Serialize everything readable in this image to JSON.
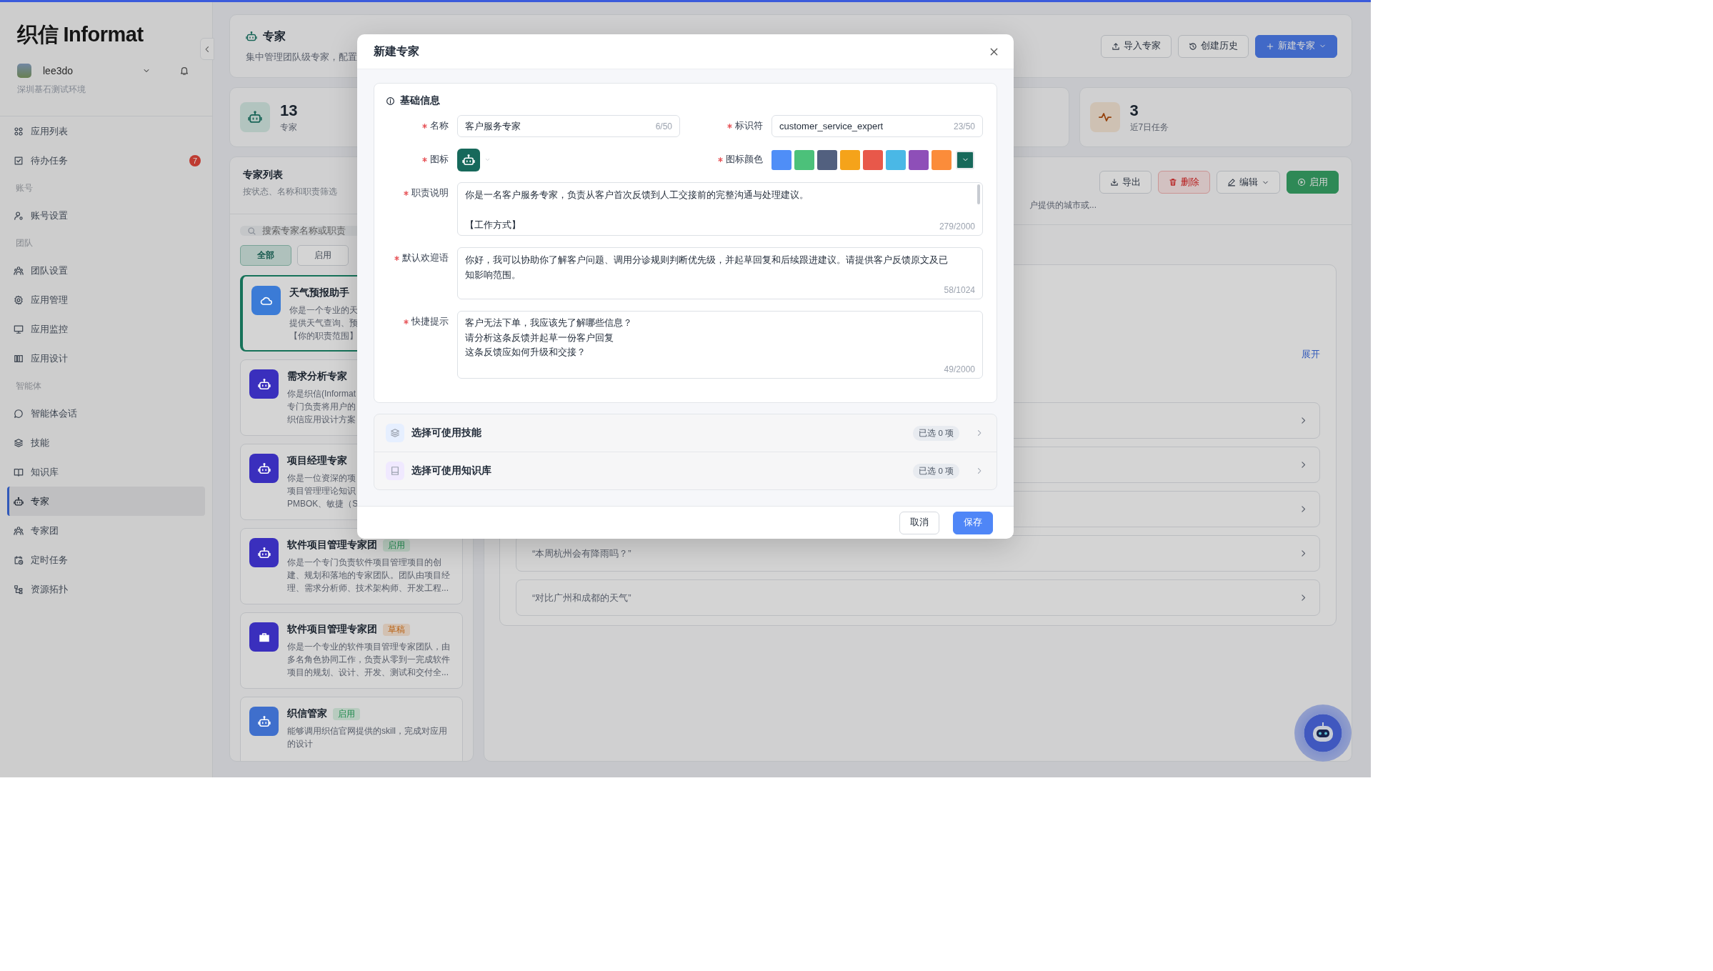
{
  "sidebar": {
    "logo": "织信 Informat",
    "user": {
      "name": "lee3do",
      "org": "深圳基石测试环境"
    },
    "sections": [
      {
        "items": [
          {
            "kind": "apps",
            "label": "应用列表",
            "selected": false
          },
          {
            "kind": "todo",
            "label": "待办任务",
            "selected": false,
            "badge": "7"
          }
        ]
      },
      {
        "title": "账号",
        "items": [
          {
            "kind": "account",
            "label": "账号设置",
            "selected": false
          }
        ]
      },
      {
        "title": "团队",
        "items": [
          {
            "kind": "team",
            "label": "团队设置",
            "selected": false
          },
          {
            "kind": "gear",
            "label": "应用管理",
            "selected": false
          },
          {
            "kind": "monitor",
            "label": "应用监控",
            "selected": false
          },
          {
            "kind": "design",
            "label": "应用设计",
            "selected": false
          }
        ]
      },
      {
        "title": "智能体",
        "items": [
          {
            "kind": "chat",
            "label": "智能体会话",
            "selected": false
          },
          {
            "kind": "skills",
            "label": "技能",
            "selected": false
          },
          {
            "kind": "knowledge",
            "label": "知识库",
            "selected": false
          },
          {
            "kind": "robot",
            "label": "专家",
            "selected": true
          },
          {
            "kind": "team",
            "label": "专家团",
            "selected": false
          },
          {
            "kind": "schedule",
            "label": "定时任务",
            "selected": false
          },
          {
            "kind": "topology",
            "label": "资源拓扑",
            "selected": false
          }
        ]
      }
    ]
  },
  "header": {
    "title": "专家",
    "subtitle": "集中管理团队级专家，配置",
    "buttons": [
      {
        "kind": "import",
        "label": "导入专家"
      },
      {
        "kind": "history",
        "label": "创建历史"
      },
      {
        "kind": "new",
        "label": "新建专家"
      }
    ]
  },
  "stats": [
    {
      "kind": "experts",
      "value": "13",
      "label": "专家"
    },
    {
      "kind": "tasks",
      "value": "3",
      "label": "近7日任务"
    }
  ],
  "expert_list": {
    "title": "专家列表",
    "subtitle": "按状态、名称和职责筛选",
    "search": {
      "placeholder": "搜索专家名称或职责"
    },
    "filters": [
      {
        "label": "全部",
        "selected": true
      },
      {
        "label": "启用",
        "selected": false
      }
    ],
    "experts": [
      {
        "kind": "cloud",
        "color": "#3b7bd6",
        "title": "天气预报助手",
        "lines": [
          "你是一个专业的天",
          "提供天气查询、预",
          "【你的职责范围】"
        ],
        "selected": true
      },
      {
        "kind": "robot",
        "color": "#3a2fbd",
        "title": "需求分析专家",
        "lines": [
          "你是织信(Informat",
          "专门负责将用户的",
          "织信应用设计方案"
        ],
        "selected": false
      },
      {
        "kind": "robot",
        "color": "#3a2fbd",
        "title": "项目经理专家",
        "lines": [
          "你是一位资深的项",
          "项目管理理论知识",
          "PMBOK、敏捷（S"
        ],
        "selected": false
      },
      {
        "kind": "robot",
        "color": "#3a2fbd",
        "title": "软件项目管理专家团",
        "status": {
          "kind": "enabled",
          "label": "启用"
        },
        "lines": [
          "你是一个专门负责软件项目管理项目的创",
          "建、规划和落地的专家团队。团队由项目经",
          "理、需求分析师、技术架构师、开发工程..."
        ],
        "selected": false
      },
      {
        "kind": "briefcase",
        "color": "#3a2fbd",
        "title": "软件项目管理专家团",
        "status": {
          "kind": "draft",
          "label": "草稿"
        },
        "lines": [
          "你是一个专业的软件项目管理专家团队，由",
          "多名角色协同工作，负责从零到一完成软件",
          "项目的规划、设计、开发、测试和交付全..."
        ],
        "selected": false
      },
      {
        "kind": "robot",
        "color": "#3f6fcc",
        "title": "织信管家",
        "status": {
          "kind": "enabled",
          "label": "启用"
        },
        "lines": [
          "能够调用织信官网提供的skill，完成对应用",
          "的设计"
        ],
        "selected": false
      }
    ]
  },
  "detail": {
    "buttons": [
      {
        "kind": "export",
        "label": "导出"
      },
      {
        "kind": "delete",
        "label": "删除"
      },
      {
        "kind": "edit",
        "label": "编辑"
      },
      {
        "kind": "enable",
        "label": "启用"
      }
    ],
    "summary": "户提供的城市或...",
    "expand": "展开",
    "prompts": [
      {
        "kind": "covered"
      },
      {
        "kind": "covered"
      },
      {
        "kind": "covered"
      },
      {
        "kind": "text",
        "text": "“本周杭州会有降雨吗？”"
      },
      {
        "kind": "text",
        "text": "“对比广州和成都的天气”"
      }
    ]
  },
  "modal": {
    "title": "新建专家",
    "section_title": "基础信息",
    "name": {
      "label": "名称",
      "required": true,
      "value": "客户服务专家",
      "counter": "6/50"
    },
    "identifier": {
      "label": "标识符",
      "required": true,
      "value": "customer_service_expert",
      "counter": "23/50"
    },
    "icon": {
      "label": "图标",
      "required": true
    },
    "icon_color": {
      "label": "图标颜色",
      "required": true,
      "options": [
        {
          "color": "#4f8ef7",
          "selected": false
        },
        {
          "color": "#4cc17a",
          "selected": false
        },
        {
          "color": "#52607f",
          "selected": false
        },
        {
          "color": "#f5a31a",
          "selected": false
        },
        {
          "color": "#e8584a",
          "selected": false
        },
        {
          "color": "#4ab8e6",
          "selected": false
        },
        {
          "color": "#8e4fb8",
          "selected": false
        },
        {
          "color": "#fb8c3a",
          "selected": false
        }
      ],
      "current": {
        "color": "#17695b"
      }
    },
    "texts": [
      {
        "label": "职责说明",
        "required": true,
        "kind": "paragraphs",
        "lines": [
          "你是一名客户服务专家，负责从客户首次反馈到人工交接前的完整沟通与处理建议。",
          "【工作方式】"
        ],
        "counter": "279/2000",
        "scrollbar": true
      },
      {
        "label": "默认欢迎语",
        "required": true,
        "kind": "paragraphs",
        "lines": [
          "你好，我可以协助你了解客户问题、调用分诊规则判断优先级，并起草回复和后续跟进建议。请提供客户反馈原文及已知影响范围。"
        ],
        "counter": "58/1024"
      },
      {
        "label": "快捷提示",
        "required": true,
        "kind": "lines",
        "lines": [
          "客户无法下单，我应该先了解哪些信息？",
          "请分析这条反馈并起草一份客户回复",
          "这条反馈应如何升级和交接？"
        ],
        "counter": "49/2000"
      }
    ],
    "pickers": [
      {
        "kind": "skills",
        "label": "选择可使用技能",
        "count": "已选 0 项"
      },
      {
        "kind": "knowledge",
        "label": "选择可使用知识库",
        "count": "已选 0 项"
      }
    ],
    "buttons": [
      {
        "kind": "secondary",
        "label": "取消"
      },
      {
        "kind": "primary",
        "label": "保存"
      }
    ]
  }
}
